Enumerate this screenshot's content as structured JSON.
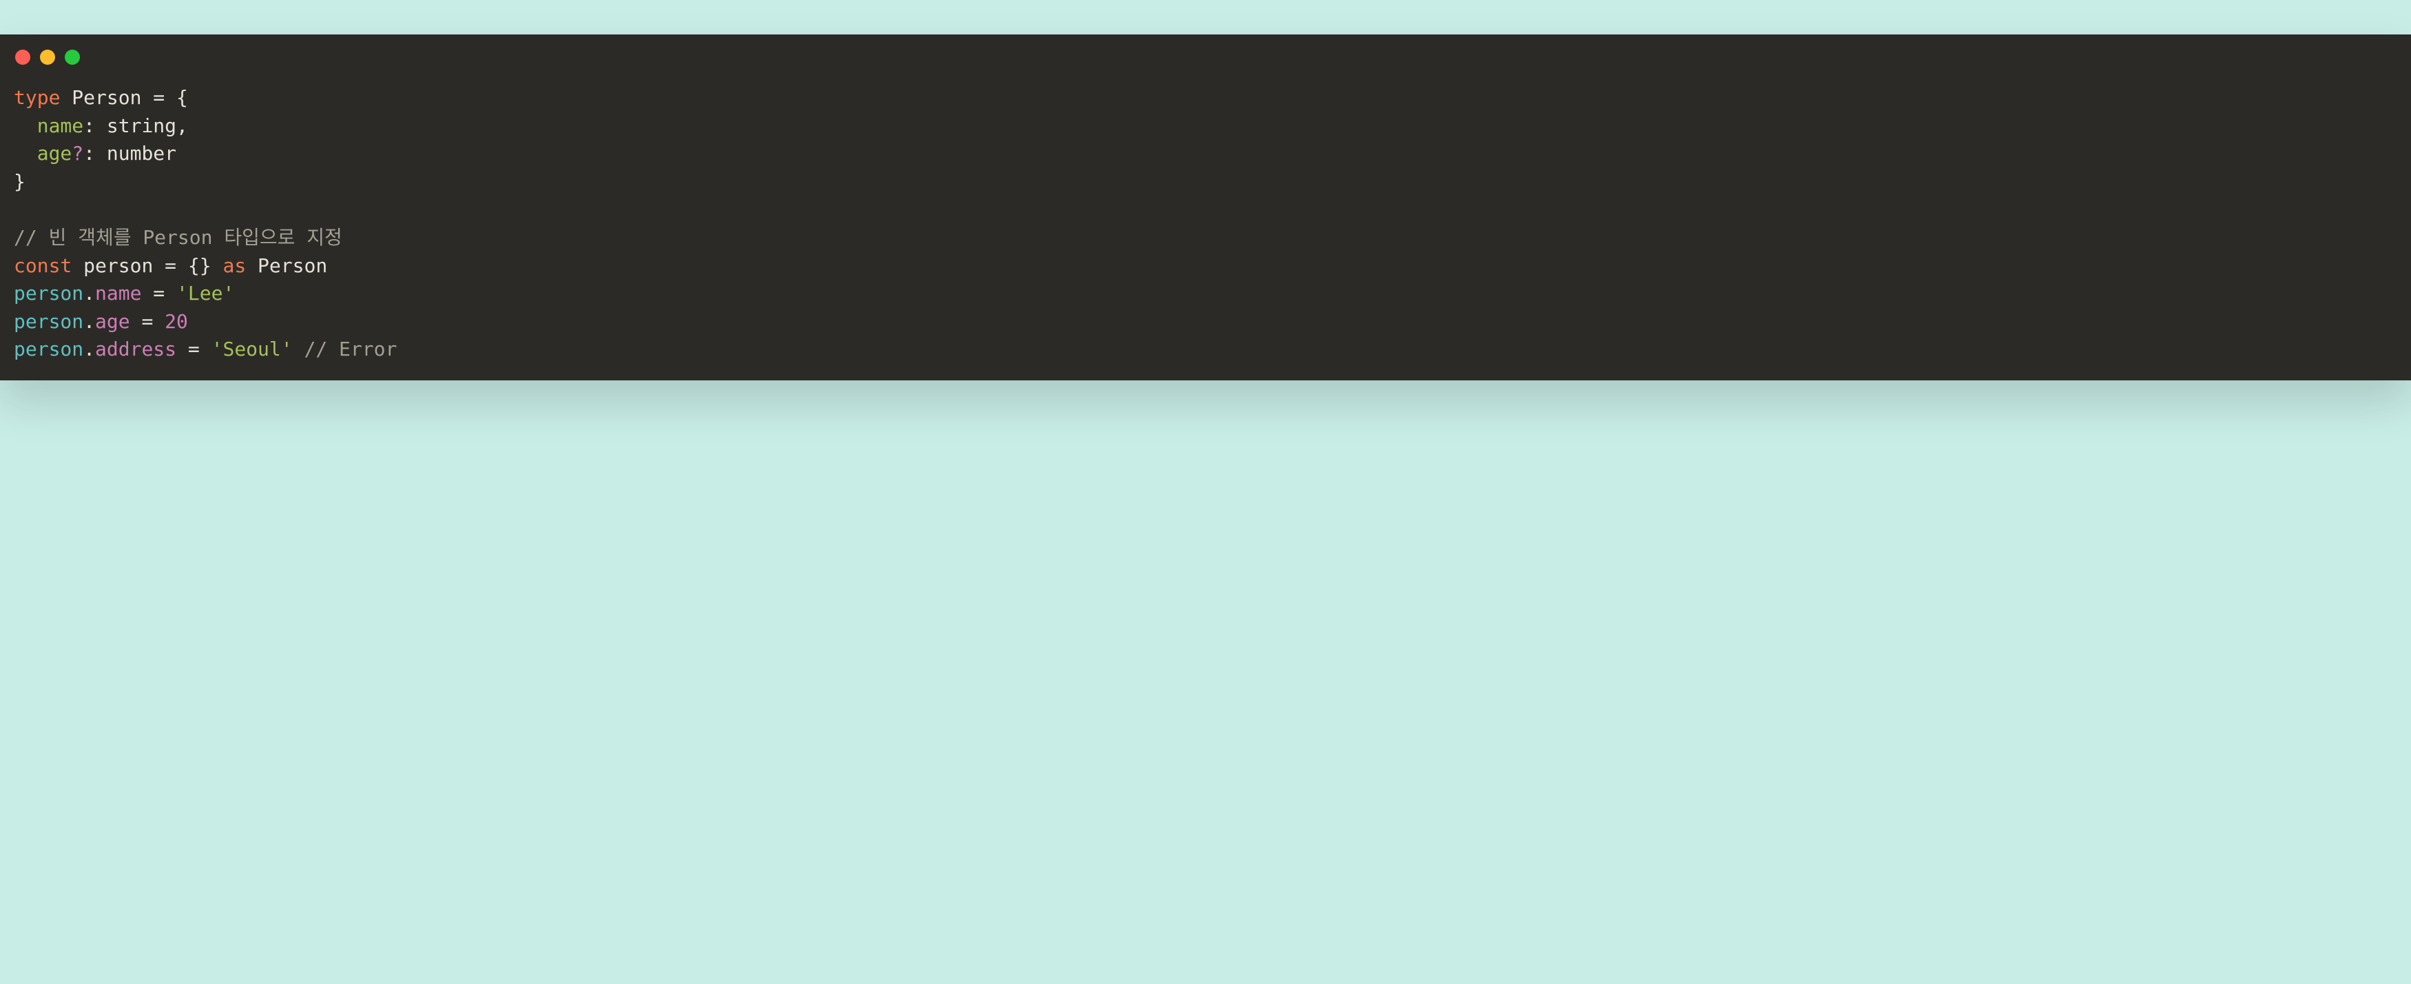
{
  "window": {
    "dots": [
      "red",
      "yellow",
      "green"
    ]
  },
  "code": {
    "l1_type": "type",
    "l1_name": "Person",
    "l1_eq": " = ",
    "l1_brace": "{",
    "l2_indent": "  ",
    "l2_prop": "name",
    "l2_colon": ": ",
    "l2_typ": "string",
    "l2_comma": ",",
    "l3_indent": "  ",
    "l3_prop": "age",
    "l3_q": "?",
    "l3_colon": ": ",
    "l3_typ": "number",
    "l4_brace": "}",
    "l6_comment": "// 빈 객체를 Person 타입으로 지정",
    "l7_const": "const",
    "l7_sp1": " ",
    "l7_var": "person",
    "l7_eq": " = ",
    "l7_obj": "{}",
    "l7_sp2": " ",
    "l7_as": "as",
    "l7_sp3": " ",
    "l7_type": "Person",
    "l8_obj": "person",
    "l8_dot": ".",
    "l8_member": "name",
    "l8_eq": " = ",
    "l8_str": "'Lee'",
    "l9_obj": "person",
    "l9_dot": ".",
    "l9_member": "age",
    "l9_eq": " = ",
    "l9_num": "20",
    "l10_obj": "person",
    "l10_dot": ".",
    "l10_member": "address",
    "l10_eq": " = ",
    "l10_str": "'Seoul'",
    "l10_sp": " ",
    "l10_comment": "// Error"
  }
}
